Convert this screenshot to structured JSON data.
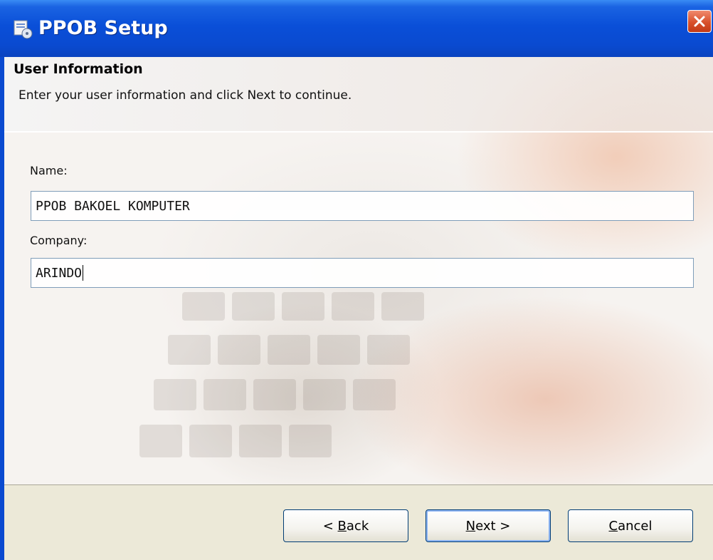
{
  "window": {
    "title": "PPOB Setup"
  },
  "header": {
    "title": "User Information",
    "subtitle": "Enter your user information and click Next to continue."
  },
  "form": {
    "name_label": "Name:",
    "name_value": "PPOB BAKOEL KOMPUTER",
    "company_label": "Company:",
    "company_value": "ARINDO"
  },
  "buttons": {
    "back": {
      "prefix": "< ",
      "mnemonic": "B",
      "rest": "ack"
    },
    "next": {
      "mnemonic": "N",
      "rest": "ext >"
    },
    "cancel": {
      "mnemonic": "C",
      "rest": "ancel"
    }
  },
  "icons": {
    "app": "setup-installer-icon",
    "close": "close-icon"
  },
  "colors": {
    "titlebar": "#0a4ad0",
    "close": "#d8512c",
    "input_border": "#7f9db9"
  }
}
